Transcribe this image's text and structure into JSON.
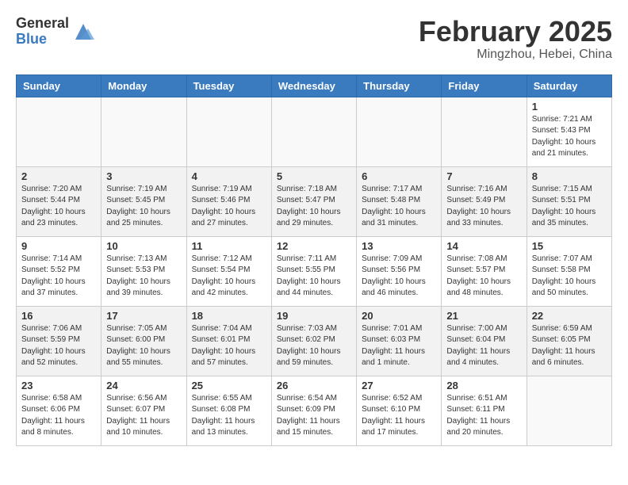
{
  "header": {
    "logo_general": "General",
    "logo_blue": "Blue",
    "month_title": "February 2025",
    "location": "Mingzhou, Hebei, China"
  },
  "weekdays": [
    "Sunday",
    "Monday",
    "Tuesday",
    "Wednesday",
    "Thursday",
    "Friday",
    "Saturday"
  ],
  "weeks": [
    [
      {
        "day": "",
        "info": ""
      },
      {
        "day": "",
        "info": ""
      },
      {
        "day": "",
        "info": ""
      },
      {
        "day": "",
        "info": ""
      },
      {
        "day": "",
        "info": ""
      },
      {
        "day": "",
        "info": ""
      },
      {
        "day": "1",
        "info": "Sunrise: 7:21 AM\nSunset: 5:43 PM\nDaylight: 10 hours\nand 21 minutes."
      }
    ],
    [
      {
        "day": "2",
        "info": "Sunrise: 7:20 AM\nSunset: 5:44 PM\nDaylight: 10 hours\nand 23 minutes."
      },
      {
        "day": "3",
        "info": "Sunrise: 7:19 AM\nSunset: 5:45 PM\nDaylight: 10 hours\nand 25 minutes."
      },
      {
        "day": "4",
        "info": "Sunrise: 7:19 AM\nSunset: 5:46 PM\nDaylight: 10 hours\nand 27 minutes."
      },
      {
        "day": "5",
        "info": "Sunrise: 7:18 AM\nSunset: 5:47 PM\nDaylight: 10 hours\nand 29 minutes."
      },
      {
        "day": "6",
        "info": "Sunrise: 7:17 AM\nSunset: 5:48 PM\nDaylight: 10 hours\nand 31 minutes."
      },
      {
        "day": "7",
        "info": "Sunrise: 7:16 AM\nSunset: 5:49 PM\nDaylight: 10 hours\nand 33 minutes."
      },
      {
        "day": "8",
        "info": "Sunrise: 7:15 AM\nSunset: 5:51 PM\nDaylight: 10 hours\nand 35 minutes."
      }
    ],
    [
      {
        "day": "9",
        "info": "Sunrise: 7:14 AM\nSunset: 5:52 PM\nDaylight: 10 hours\nand 37 minutes."
      },
      {
        "day": "10",
        "info": "Sunrise: 7:13 AM\nSunset: 5:53 PM\nDaylight: 10 hours\nand 39 minutes."
      },
      {
        "day": "11",
        "info": "Sunrise: 7:12 AM\nSunset: 5:54 PM\nDaylight: 10 hours\nand 42 minutes."
      },
      {
        "day": "12",
        "info": "Sunrise: 7:11 AM\nSunset: 5:55 PM\nDaylight: 10 hours\nand 44 minutes."
      },
      {
        "day": "13",
        "info": "Sunrise: 7:09 AM\nSunset: 5:56 PM\nDaylight: 10 hours\nand 46 minutes."
      },
      {
        "day": "14",
        "info": "Sunrise: 7:08 AM\nSunset: 5:57 PM\nDaylight: 10 hours\nand 48 minutes."
      },
      {
        "day": "15",
        "info": "Sunrise: 7:07 AM\nSunset: 5:58 PM\nDaylight: 10 hours\nand 50 minutes."
      }
    ],
    [
      {
        "day": "16",
        "info": "Sunrise: 7:06 AM\nSunset: 5:59 PM\nDaylight: 10 hours\nand 52 minutes."
      },
      {
        "day": "17",
        "info": "Sunrise: 7:05 AM\nSunset: 6:00 PM\nDaylight: 10 hours\nand 55 minutes."
      },
      {
        "day": "18",
        "info": "Sunrise: 7:04 AM\nSunset: 6:01 PM\nDaylight: 10 hours\nand 57 minutes."
      },
      {
        "day": "19",
        "info": "Sunrise: 7:03 AM\nSunset: 6:02 PM\nDaylight: 10 hours\nand 59 minutes."
      },
      {
        "day": "20",
        "info": "Sunrise: 7:01 AM\nSunset: 6:03 PM\nDaylight: 11 hours\nand 1 minute."
      },
      {
        "day": "21",
        "info": "Sunrise: 7:00 AM\nSunset: 6:04 PM\nDaylight: 11 hours\nand 4 minutes."
      },
      {
        "day": "22",
        "info": "Sunrise: 6:59 AM\nSunset: 6:05 PM\nDaylight: 11 hours\nand 6 minutes."
      }
    ],
    [
      {
        "day": "23",
        "info": "Sunrise: 6:58 AM\nSunset: 6:06 PM\nDaylight: 11 hours\nand 8 minutes."
      },
      {
        "day": "24",
        "info": "Sunrise: 6:56 AM\nSunset: 6:07 PM\nDaylight: 11 hours\nand 10 minutes."
      },
      {
        "day": "25",
        "info": "Sunrise: 6:55 AM\nSunset: 6:08 PM\nDaylight: 11 hours\nand 13 minutes."
      },
      {
        "day": "26",
        "info": "Sunrise: 6:54 AM\nSunset: 6:09 PM\nDaylight: 11 hours\nand 15 minutes."
      },
      {
        "day": "27",
        "info": "Sunrise: 6:52 AM\nSunset: 6:10 PM\nDaylight: 11 hours\nand 17 minutes."
      },
      {
        "day": "28",
        "info": "Sunrise: 6:51 AM\nSunset: 6:11 PM\nDaylight: 11 hours\nand 20 minutes."
      },
      {
        "day": "",
        "info": ""
      }
    ]
  ]
}
